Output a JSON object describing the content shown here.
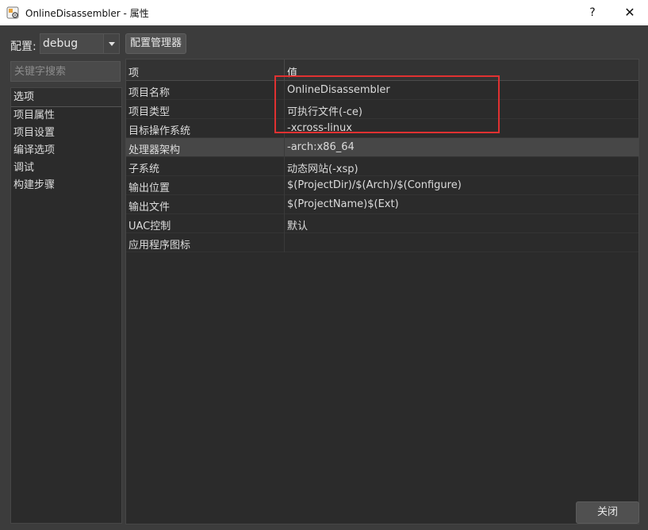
{
  "window": {
    "title": "OnlineDisassembler - 属性",
    "help_label": "?",
    "close_label": "✕"
  },
  "config": {
    "label": "配置:",
    "selected": "debug",
    "manager_button": "配置管理器"
  },
  "search": {
    "placeholder": "关键字搜索"
  },
  "nav": {
    "header": "选项",
    "items": [
      {
        "label": "项目属性"
      },
      {
        "label": "项目设置"
      },
      {
        "label": "编译选项"
      },
      {
        "label": "调试"
      },
      {
        "label": "构建步骤"
      }
    ]
  },
  "grid": {
    "header_key": "项",
    "header_value": "值",
    "rows": [
      {
        "key": "项目名称",
        "value": "OnlineDisassembler"
      },
      {
        "key": "项目类型",
        "value": "可执行文件(-ce)"
      },
      {
        "key": "目标操作系统",
        "value": "-xcross-linux"
      },
      {
        "key": "处理器架构",
        "value": "-arch:x86_64"
      },
      {
        "key": "子系统",
        "value": "动态网站(-xsp)"
      },
      {
        "key": "输出位置",
        "value": "$(ProjectDir)/$(Arch)/$(Configure)"
      },
      {
        "key": "输出文件",
        "value": "$(ProjectName)$(Ext)"
      },
      {
        "key": "UAC控制",
        "value": "默认"
      },
      {
        "key": "应用程序图标",
        "value": ""
      }
    ]
  },
  "footer": {
    "close_button": "关闭"
  },
  "colors": {
    "highlight": "#e03131",
    "background": "#3c3c3c",
    "panel": "#2b2b2b",
    "selected_row": "#474747"
  }
}
